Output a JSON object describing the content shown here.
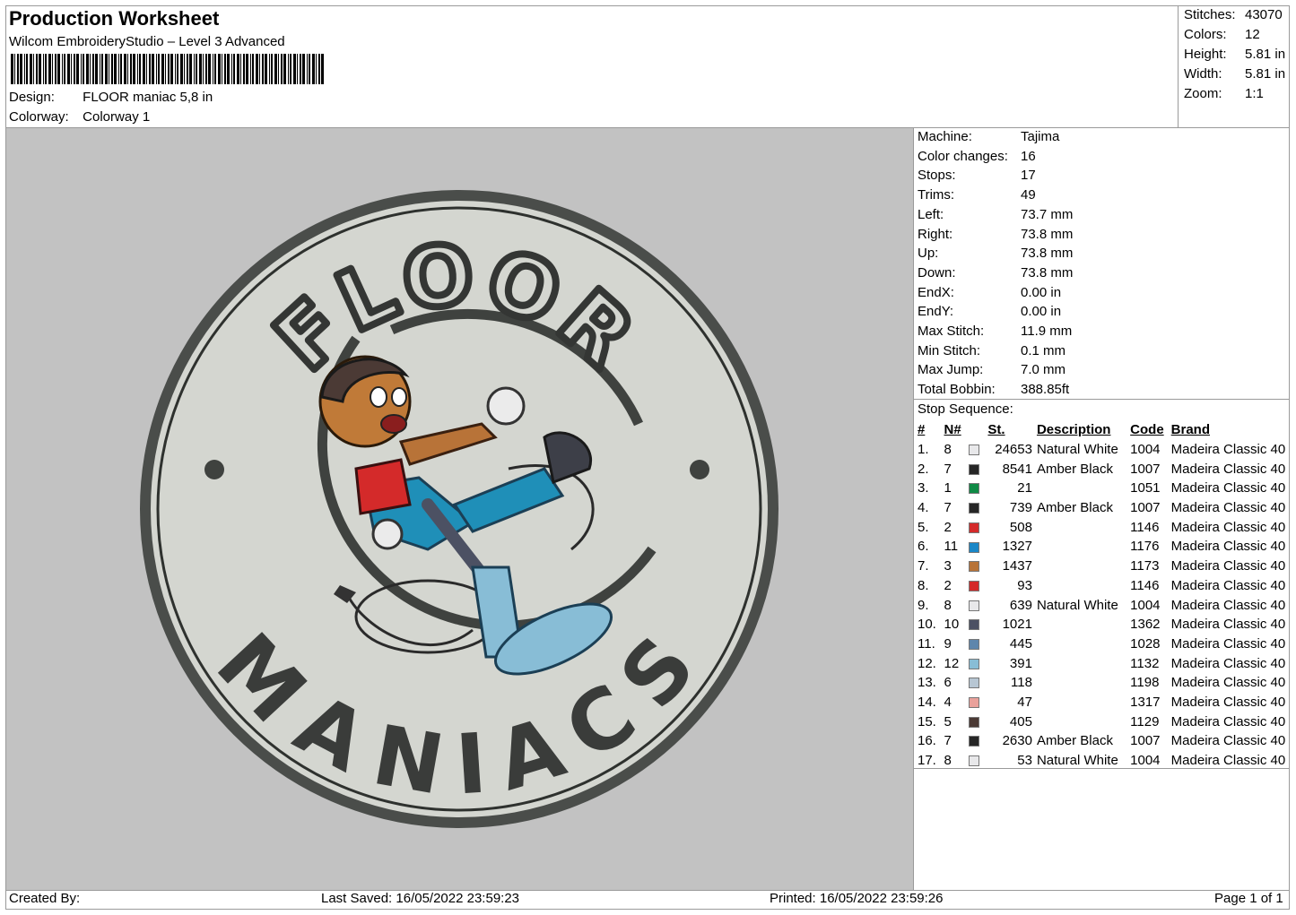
{
  "header": {
    "title": "Production Worksheet",
    "software": "Wilcom EmbroideryStudio – Level 3 Advanced",
    "design_label": "Design:",
    "design_value": "FLOOR maniac 5,8 in",
    "colorway_label": "Colorway:",
    "colorway_value": "Colorway 1"
  },
  "summary": [
    {
      "label": "Stitches:",
      "value": "43070"
    },
    {
      "label": "Colors:",
      "value": "12"
    },
    {
      "label": "Height:",
      "value": "5.81 in"
    },
    {
      "label": "Width:",
      "value": "5.81 in"
    },
    {
      "label": "Zoom:",
      "value": "1:1"
    }
  ],
  "machine_info": [
    {
      "label": "Machine:",
      "value": "Tajima"
    },
    {
      "label": "Color changes:",
      "value": "16"
    },
    {
      "label": "Stops:",
      "value": "17"
    },
    {
      "label": "Trims:",
      "value": "49"
    },
    {
      "label": "Left:",
      "value": "73.7 mm"
    },
    {
      "label": "Right:",
      "value": "73.8 mm"
    },
    {
      "label": "Up:",
      "value": "73.8 mm"
    },
    {
      "label": "Down:",
      "value": "73.8 mm"
    },
    {
      "label": "EndX:",
      "value": "0.00 in"
    },
    {
      "label": "EndY:",
      "value": "0.00 in"
    },
    {
      "label": "Max Stitch:",
      "value": "11.9 mm"
    },
    {
      "label": "Min Stitch:",
      "value": "0.1 mm"
    },
    {
      "label": "Max Jump:",
      "value": "7.0 mm"
    },
    {
      "label": "Total Bobbin:",
      "value": "388.85ft"
    }
  ],
  "stop_sequence": {
    "title": "Stop Sequence:",
    "columns": [
      "#",
      "N#",
      "St.",
      "Description",
      "Code",
      "Brand"
    ],
    "rows": [
      {
        "idx": "1.",
        "n": "8",
        "color": "#e8e8ea",
        "st": "24653",
        "desc": "Natural White",
        "code": "1004",
        "brand": "Madeira Classic 40"
      },
      {
        "idx": "2.",
        "n": "7",
        "color": "#262626",
        "st": "8541",
        "desc": "Amber Black",
        "code": "1007",
        "brand": "Madeira Classic 40"
      },
      {
        "idx": "3.",
        "n": "1",
        "color": "#0f8a45",
        "st": "21",
        "desc": "",
        "code": "1051",
        "brand": "Madeira Classic 40"
      },
      {
        "idx": "4.",
        "n": "7",
        "color": "#262626",
        "st": "739",
        "desc": "Amber Black",
        "code": "1007",
        "brand": "Madeira Classic 40"
      },
      {
        "idx": "5.",
        "n": "2",
        "color": "#d42a2a",
        "st": "508",
        "desc": "",
        "code": "1146",
        "brand": "Madeira Classic 40"
      },
      {
        "idx": "6.",
        "n": "11",
        "color": "#1a87c7",
        "st": "1327",
        "desc": "",
        "code": "1176",
        "brand": "Madeira Classic 40"
      },
      {
        "idx": "7.",
        "n": "3",
        "color": "#b87338",
        "st": "1437",
        "desc": "",
        "code": "1173",
        "brand": "Madeira Classic 40"
      },
      {
        "idx": "8.",
        "n": "2",
        "color": "#d42a2a",
        "st": "93",
        "desc": "",
        "code": "1146",
        "brand": "Madeira Classic 40"
      },
      {
        "idx": "9.",
        "n": "8",
        "color": "#e8e8ea",
        "st": "639",
        "desc": "Natural White",
        "code": "1004",
        "brand": "Madeira Classic 40"
      },
      {
        "idx": "10.",
        "n": "10",
        "color": "#4c5163",
        "st": "1021",
        "desc": "",
        "code": "1362",
        "brand": "Madeira Classic 40"
      },
      {
        "idx": "11.",
        "n": "9",
        "color": "#5e86ac",
        "st": "445",
        "desc": "",
        "code": "1028",
        "brand": "Madeira Classic 40"
      },
      {
        "idx": "12.",
        "n": "12",
        "color": "#88bdd6",
        "st": "391",
        "desc": "",
        "code": "1132",
        "brand": "Madeira Classic 40"
      },
      {
        "idx": "13.",
        "n": "6",
        "color": "#b7c6d3",
        "st": "118",
        "desc": "",
        "code": "1198",
        "brand": "Madeira Classic 40"
      },
      {
        "idx": "14.",
        "n": "4",
        "color": "#e9a19b",
        "st": "47",
        "desc": "",
        "code": "1317",
        "brand": "Madeira Classic 40"
      },
      {
        "idx": "15.",
        "n": "5",
        "color": "#4b3a35",
        "st": "405",
        "desc": "",
        "code": "1129",
        "brand": "Madeira Classic 40"
      },
      {
        "idx": "16.",
        "n": "7",
        "color": "#262626",
        "st": "2630",
        "desc": "Amber Black",
        "code": "1007",
        "brand": "Madeira Classic 40"
      },
      {
        "idx": "17.",
        "n": "8",
        "color": "#e8e8ea",
        "st": "53",
        "desc": "Natural White",
        "code": "1004",
        "brand": "Madeira Classic 40"
      }
    ]
  },
  "design_preview": {
    "top_text": "FLOOR",
    "bottom_text": "MANIACS",
    "background_color": "#c2c2c2",
    "patch_color": "#d4d6d0",
    "outline_color": "#4a4d4a"
  },
  "footer": {
    "created_by": "Created By:",
    "last_saved": "Last Saved: 16/05/2022 23:59:23",
    "printed": "Printed: 16/05/2022 23:59:26",
    "page": "Page 1 of 1"
  }
}
